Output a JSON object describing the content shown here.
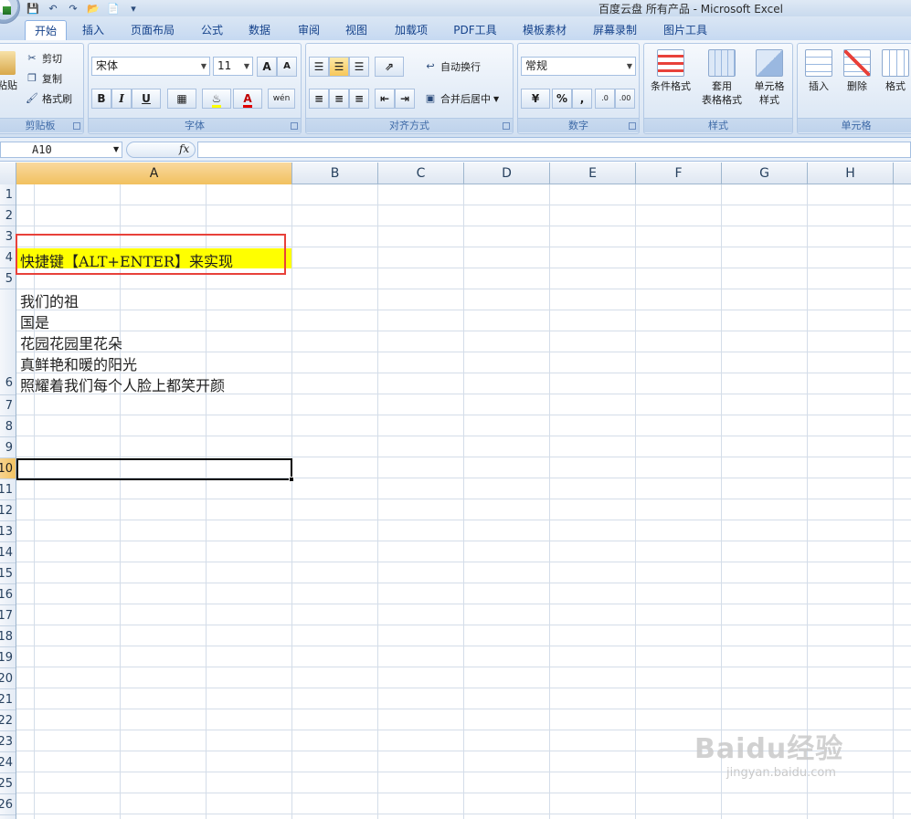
{
  "window": {
    "title": "百度云盘 所有产品 - Microsoft Excel"
  },
  "tabs": [
    "开始",
    "插入",
    "页面布局",
    "公式",
    "数据",
    "审阅",
    "视图",
    "加载项",
    "PDF工具",
    "模板素材",
    "屏幕录制",
    "图片工具"
  ],
  "ribbon": {
    "clipboard": {
      "paste": "粘贴",
      "cut": "剪切",
      "copy": "复制",
      "format_painter": "格式刷",
      "label": "剪贴板"
    },
    "font": {
      "name": "宋体",
      "size": "11",
      "grow": "A",
      "shrink": "A",
      "bold": "B",
      "italic": "I",
      "underline": "U",
      "font_color": "A",
      "phonetic": "wén",
      "label": "字体"
    },
    "alignment": {
      "wrap": "自动换行",
      "merge": "合并后居中",
      "label": "对齐方式"
    },
    "number": {
      "format": "常规",
      "percent": "%",
      "comma": ",",
      "inc_decimal": ".0",
      "dec_decimal": ".00",
      "label": "数字"
    },
    "styles": {
      "conditional": "条件格式",
      "table_line1": "套用",
      "table_line2": "表格格式",
      "cell_line1": "单元格",
      "cell_line2": "样式",
      "label": "样式"
    },
    "cells": {
      "insert": "插入",
      "delete": "删除",
      "format": "格式",
      "label": "单元格"
    }
  },
  "formula_bar": {
    "name_box": "A10",
    "fx": "fx",
    "value": ""
  },
  "columns": [
    "A",
    "B",
    "C",
    "D",
    "E",
    "F",
    "G",
    "H"
  ],
  "rows": [
    "1",
    "2",
    "3",
    "4",
    "5",
    "6",
    "7",
    "8",
    "9",
    "10",
    "11",
    "12",
    "13",
    "14",
    "15",
    "16",
    "17",
    "18",
    "19",
    "20",
    "21",
    "22",
    "23",
    "24",
    "25",
    "26"
  ],
  "cells": {
    "A4": "快捷键【ALT+ENTER】来实现",
    "A6_lines": [
      "我们的祖",
      "国是",
      "花园花园里花朵",
      "真鲜艳和暖的阳光",
      "照耀着我们每个人脸上都笑开颜"
    ]
  },
  "watermark": {
    "brand": "Baidu经验",
    "url": "jingyan.baidu.com"
  }
}
